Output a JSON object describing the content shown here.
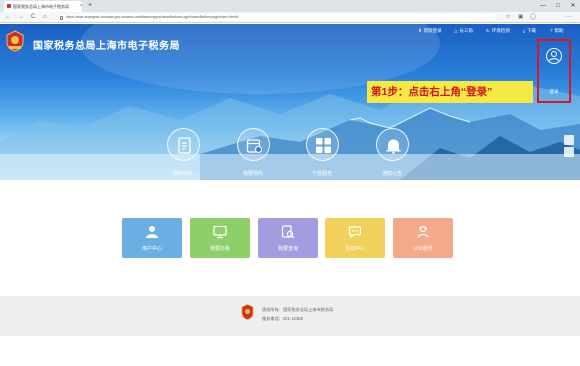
{
  "browser": {
    "tab_title": "国家税务总局上海市电子税务局",
    "tab_close": "×",
    "new_tab": "+",
    "url": "https://etax.shanghai.chinatax.gov.cn/wszx-web/bszm/apps/views/beforeLogin/indexBefore/pageIndex.html#/",
    "nav": {
      "back": "←",
      "forward": "→",
      "reload": "C",
      "home": "⌂"
    },
    "window_controls": {
      "minimize": "—",
      "maximize": "□",
      "close": "✕"
    }
  },
  "header": {
    "site_title": "国家税务总局上海市电子税务局",
    "links": [
      {
        "label": "新版登录",
        "icon": "arrow-up-icon"
      },
      {
        "label": "长三角",
        "icon": "triangle-icon"
      },
      {
        "label": "环境检测",
        "icon": "refresh-icon"
      },
      {
        "label": "下载",
        "icon": "download-icon"
      },
      {
        "label": "帮助",
        "icon": "help-icon"
      }
    ],
    "login_label": "登录",
    "step_banner": "第1步：点击右上角“登录”"
  },
  "features": [
    {
      "label": "我的待办",
      "icon": "todo-icon"
    },
    {
      "label": "我要预约",
      "icon": "calendar-icon"
    },
    {
      "label": "个性服务",
      "icon": "grid-icon"
    },
    {
      "label": "通知公告",
      "icon": "bell-icon"
    }
  ],
  "tiles": [
    {
      "label": "用户中心",
      "color": "#6aaee2",
      "icon": "user-icon"
    },
    {
      "label": "我要办税",
      "color": "#8fcf6a",
      "icon": "monitor-icon"
    },
    {
      "label": "我要查询",
      "color": "#a39de0",
      "icon": "search-doc-icon"
    },
    {
      "label": "互动中心",
      "color": "#f2d15a",
      "icon": "chat-icon"
    },
    {
      "label": "公众服务",
      "color": "#f4a98a",
      "icon": "service-icon"
    }
  ],
  "footer": {
    "line1": "版权所有：国家税务总局上海市税务局",
    "line2": "服务电话：021-12366"
  },
  "colors": {
    "accent_red": "#e1141d",
    "banner_yellow": "#f4e842",
    "hero_blue": "#2a82dc"
  }
}
